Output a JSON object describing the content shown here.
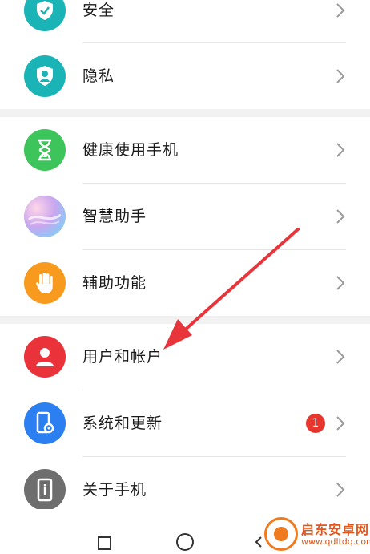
{
  "settings": {
    "items": [
      {
        "label": "安全",
        "icon": "shield-check-icon",
        "color": "#1bb4b6"
      },
      {
        "label": "隐私",
        "icon": "privacy-shield-icon",
        "color": "#1bb4b6"
      },
      {
        "label": "健康使用手机",
        "icon": "hourglass-icon",
        "color": "#3dc45a"
      },
      {
        "label": "智慧助手",
        "icon": "assistant-orb-icon",
        "color": "#b89ce8"
      },
      {
        "label": "辅助功能",
        "icon": "hand-icon",
        "color": "#f79a1d"
      },
      {
        "label": "用户和帐户",
        "icon": "user-icon",
        "color": "#e9323a"
      },
      {
        "label": "系统和更新",
        "icon": "phone-gear-icon",
        "color": "#2b7ff0",
        "badge": "1"
      },
      {
        "label": "关于手机",
        "icon": "phone-info-icon",
        "color": "#6e6e6e"
      }
    ]
  },
  "watermark": {
    "text": "启东安卓网",
    "url": "www.qdltdq.com"
  },
  "colors": {
    "accent_arrow": "#e8353b",
    "badge": "#e8352e"
  }
}
